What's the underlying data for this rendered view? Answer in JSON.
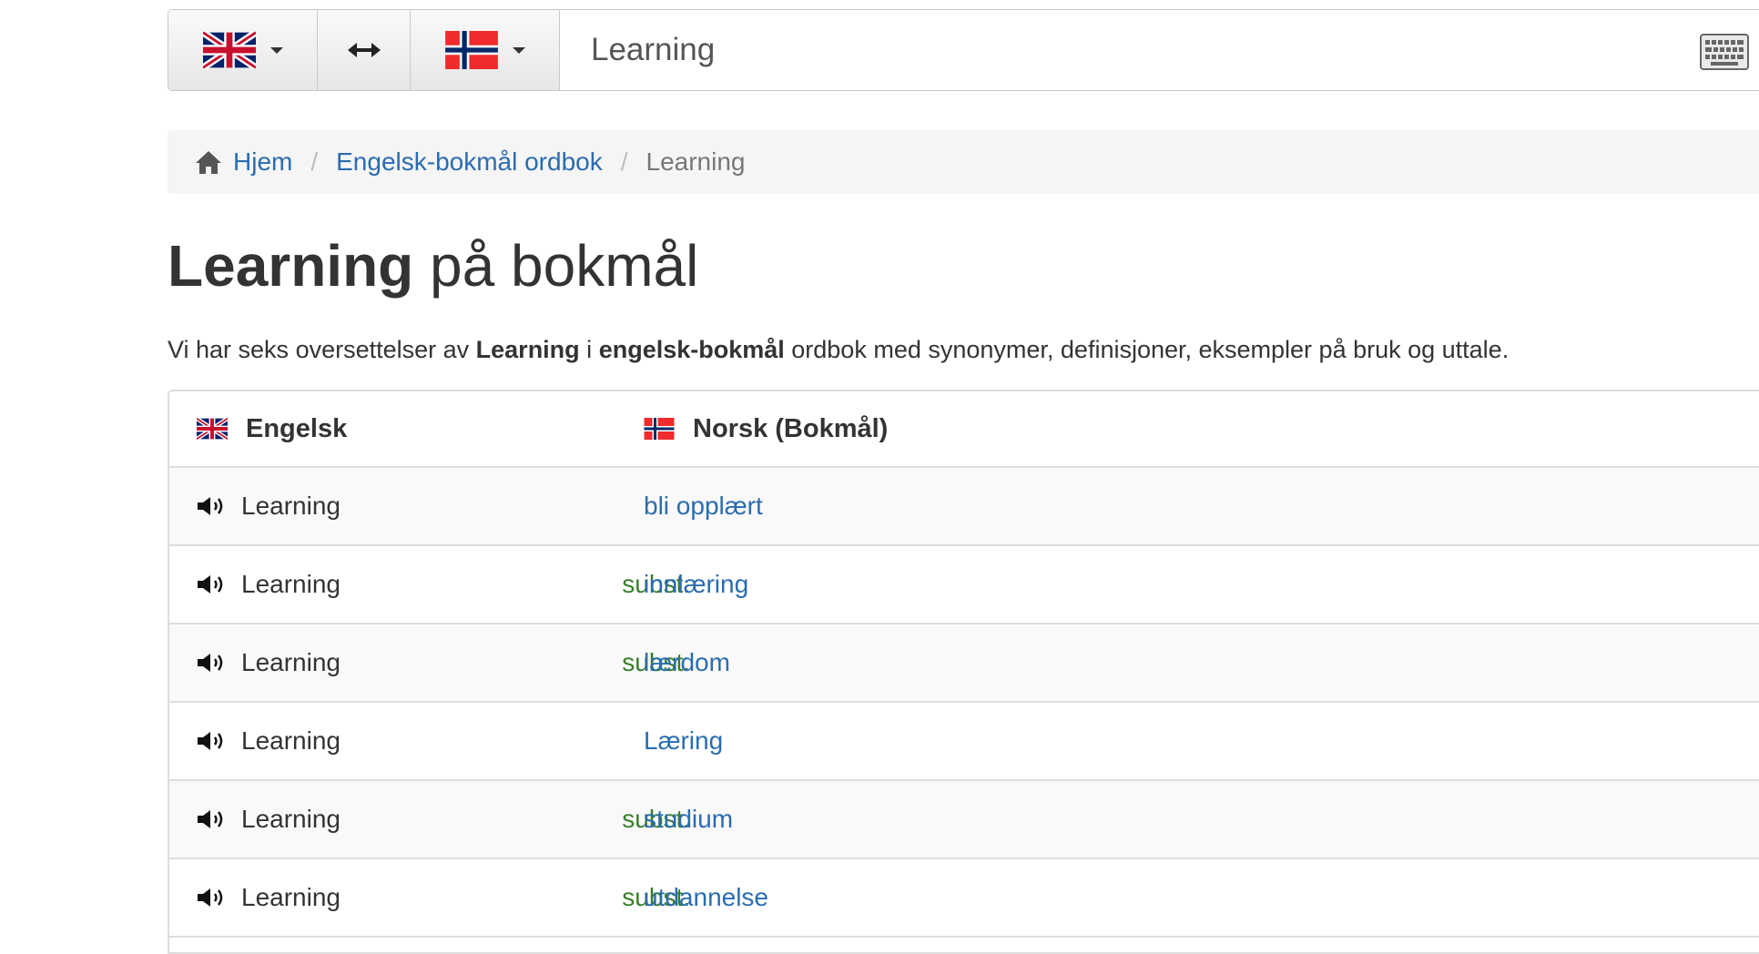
{
  "search": {
    "source_flag": "uk-flag-icon",
    "swap_icon": "swap-arrows-icon",
    "target_flag": "norway-flag-icon",
    "query": "Learning",
    "keyboard_icon": "keyboard-icon"
  },
  "breadcrumb": {
    "home": "Hjem",
    "dictionary": "Engelsk-bokmål ordbok",
    "current": "Learning",
    "separator": "/"
  },
  "heading": {
    "word": "Learning",
    "rest": " på bokmål"
  },
  "intro": {
    "p1": "Vi har seks oversettelser av ",
    "word": "Learning",
    "p2": " i ",
    "dict": "engelsk-bokmål",
    "p3": " ordbok med synonymer, definisjoner, eksempler på bruk og uttale."
  },
  "table": {
    "col_source": "Engelsk",
    "col_target": "Norsk (Bokmål)",
    "rows": [
      {
        "word": "Learning",
        "pos": "",
        "translation": "bli opplært"
      },
      {
        "word": "Learning",
        "pos": "subst.",
        "translation": "innlæring"
      },
      {
        "word": "Learning",
        "pos": "subst.",
        "translation": "lærdom"
      },
      {
        "word": "Learning",
        "pos": "",
        "translation": "Læring"
      },
      {
        "word": "Learning",
        "pos": "subst.",
        "translation": "studium"
      },
      {
        "word": "Learning",
        "pos": "subst.",
        "translation": "utdannelse"
      }
    ]
  },
  "colors": {
    "link": "#2a6cb0",
    "pos": "#3a7d2d",
    "border": "#dddddd"
  }
}
